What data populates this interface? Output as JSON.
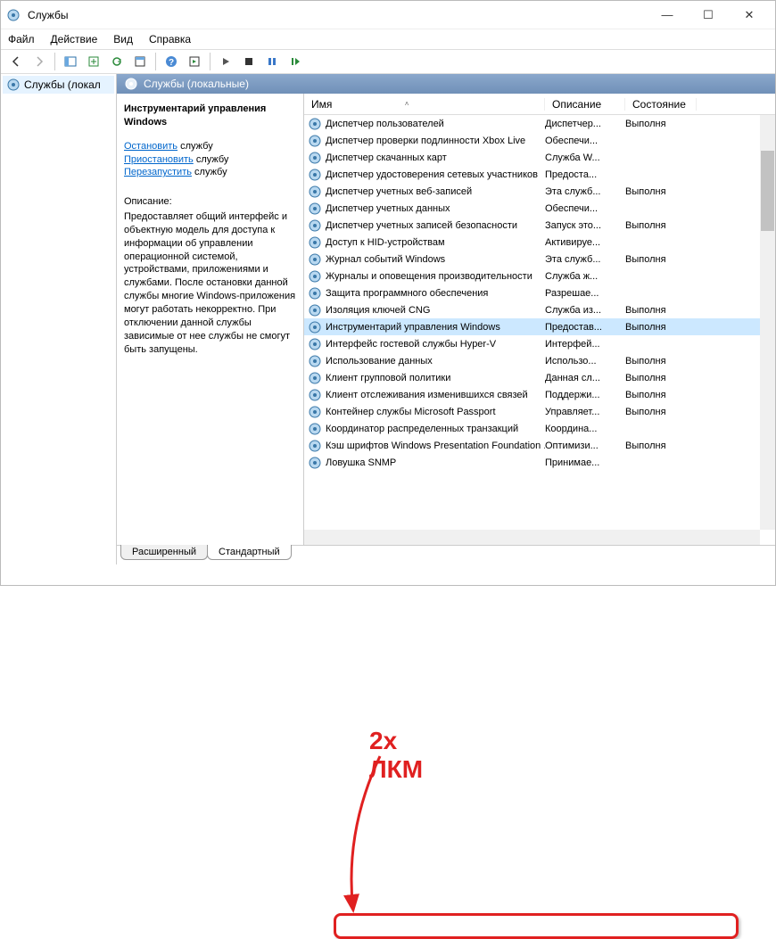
{
  "window": {
    "title": "Службы"
  },
  "menu": {
    "file": "Файл",
    "action": "Действие",
    "view": "Вид",
    "help": "Справка"
  },
  "tree": {
    "root": "Службы (локал"
  },
  "pane": {
    "header": "Службы (локальные)"
  },
  "details": {
    "name_line1": "Инструментарий управления",
    "name_line2": "Windows",
    "stop": "Остановить",
    "pause": "Приостановить",
    "restart": "Перезапустить",
    "service_word": "службу",
    "desc_label": "Описание:",
    "desc_text": "Предоставляет общий интерфейс и объектную модель для доступа к информации об управлении операционной системой, устройствами, приложениями и службами. После остановки данной службы многие Windows-приложения могут работать некорректно. При отключении данной службы зависимые от нее службы не смогут быть запущены."
  },
  "columns": {
    "name": "Имя",
    "desc": "Описание",
    "state": "Состояние"
  },
  "tabs": {
    "extended": "Расширенный",
    "standard": "Стандартный"
  },
  "annotation": {
    "text": "2х ЛКМ"
  },
  "services": [
    {
      "name": "Диспетчер пользователей",
      "desc": "Диспетчер...",
      "state": "Выполня"
    },
    {
      "name": "Диспетчер проверки подлинности Xbox Live",
      "desc": "Обеспечи...",
      "state": ""
    },
    {
      "name": "Диспетчер скачанных карт",
      "desc": "Служба W...",
      "state": ""
    },
    {
      "name": "Диспетчер удостоверения сетевых участников",
      "desc": "Предоста...",
      "state": ""
    },
    {
      "name": "Диспетчер учетных веб-записей",
      "desc": "Эта служб...",
      "state": "Выполня"
    },
    {
      "name": "Диспетчер учетных данных",
      "desc": "Обеспечи...",
      "state": ""
    },
    {
      "name": "Диспетчер учетных записей безопасности",
      "desc": "Запуск это...",
      "state": "Выполня"
    },
    {
      "name": "Доступ к HID-устройствам",
      "desc": "Активируе...",
      "state": ""
    },
    {
      "name": "Журнал событий Windows",
      "desc": "Эта служб...",
      "state": "Выполня"
    },
    {
      "name": "Журналы и оповещения производительности",
      "desc": "Служба ж...",
      "state": ""
    },
    {
      "name": "Защита программного обеспечения",
      "desc": "Разрешае...",
      "state": ""
    },
    {
      "name": "Изоляция ключей CNG",
      "desc": "Служба из...",
      "state": "Выполня"
    },
    {
      "name": "Инструментарий управления Windows",
      "desc": "Предостав...",
      "state": "Выполня",
      "selected": true
    },
    {
      "name": "Интерфейс гостевой службы Hyper-V",
      "desc": "Интерфей...",
      "state": ""
    },
    {
      "name": "Использование данных",
      "desc": "Использо...",
      "state": "Выполня"
    },
    {
      "name": "Клиент групповой политики",
      "desc": "Данная сл...",
      "state": "Выполня"
    },
    {
      "name": "Клиент отслеживания изменившихся связей",
      "desc": "Поддержи...",
      "state": "Выполня"
    },
    {
      "name": "Контейнер службы Microsoft Passport",
      "desc": "Управляет...",
      "state": "Выполня"
    },
    {
      "name": "Координатор распределенных транзакций",
      "desc": "Координа...",
      "state": ""
    },
    {
      "name": "Кэш шрифтов Windows Presentation Foundation ...",
      "desc": "Оптимизи...",
      "state": "Выполня"
    },
    {
      "name": "Ловушка SNMP",
      "desc": "Принимае...",
      "state": ""
    }
  ]
}
